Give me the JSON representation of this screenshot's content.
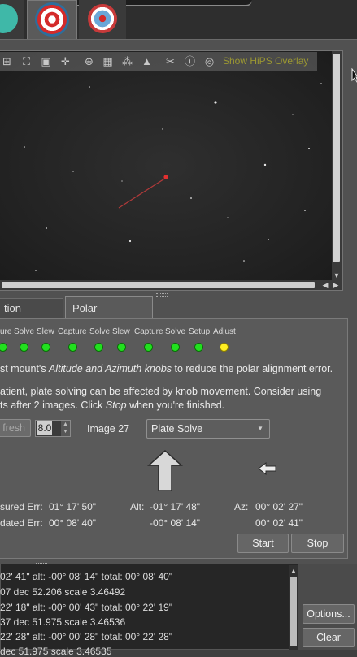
{
  "image_toolbar": {
    "hips_label": "Show HiPS Overlay"
  },
  "tabs": {
    "results": "tion Results",
    "polar_alignment": "Polar Alignment"
  },
  "steps": [
    {
      "label": "ure",
      "state": "done"
    },
    {
      "label": "Solve",
      "state": "done"
    },
    {
      "label": "Slew",
      "state": "done"
    },
    {
      "label": "Capture",
      "state": "done"
    },
    {
      "label": "Solve",
      "state": "done"
    },
    {
      "label": "Slew",
      "state": "done"
    },
    {
      "label": "Capture",
      "state": "done"
    },
    {
      "label": "Solve",
      "state": "done"
    },
    {
      "label": "Setup",
      "state": "done"
    },
    {
      "label": "Adjust",
      "state": "active"
    }
  ],
  "instructions": {
    "line1_pre": "st mount's ",
    "line1_em": "Altitude and Azimuth knobs",
    "line1_post": " to reduce the polar alignment error.",
    "line2": "atient, plate solving can be affected by knob movement. Consider using",
    "line3_pre": "ts after 2 images. Click ",
    "line3_em": "Stop",
    "line3_post": " when you're finished."
  },
  "controls": {
    "refresh_label": "fresh",
    "interval_value": "8.0",
    "image_count": "Image 27",
    "method_selected": "Plate Solve"
  },
  "errors": {
    "measured_label": "sured Err:",
    "measured_value": "01° 17' 50\"",
    "updated_label": "dated Err:",
    "updated_value": "00° 08' 40\"",
    "alt_label": "Alt:",
    "alt_measured": "-01° 17' 48\"",
    "alt_updated": "-00° 08' 14\"",
    "az_label": "Az:",
    "az_measured": "00° 02' 27\"",
    "az_updated": "00° 02' 41\""
  },
  "buttons": {
    "start": "Start",
    "stop": "Stop",
    "options": "Options...",
    "clear": "Clear"
  },
  "log": [
    "02' 41\" alt: -00° 08' 14\" total:  00° 08' 40\"",
    "07 dec 52.206 scale 3.46492",
    "22' 18\" alt: -00° 00' 43\" total:  00° 22' 19\"",
    "37 dec 51.975 scale 3.46536",
    "22' 28\" alt: -00° 00' 28\" total:  00° 22' 28\"",
    "   dec 51.975 scale 3.46535"
  ],
  "colors": {
    "led_done": "#22e01f",
    "led_active": "#ffee22",
    "hips_text": "#9b9732"
  }
}
